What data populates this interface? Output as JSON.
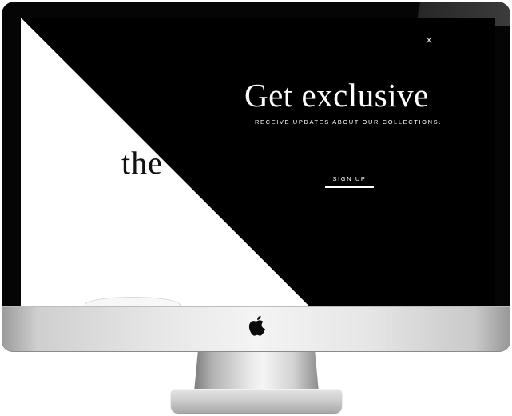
{
  "page": {
    "headline": "the"
  },
  "popup": {
    "close_label": "X",
    "title": "Get exclusive",
    "subtitle": "RECEIVE UPDATES ABOUT OUR COLLECTIONS.",
    "signup_label": "SIGN UP"
  },
  "device": {
    "logo_icon": "apple-logo-icon"
  },
  "colors": {
    "popup_background": "#000000",
    "popup_text": "#ffffff",
    "page_background": "#ffffff",
    "page_text": "#111111",
    "monitor_bezel": "#050505",
    "monitor_body": "#e6e6e6"
  }
}
